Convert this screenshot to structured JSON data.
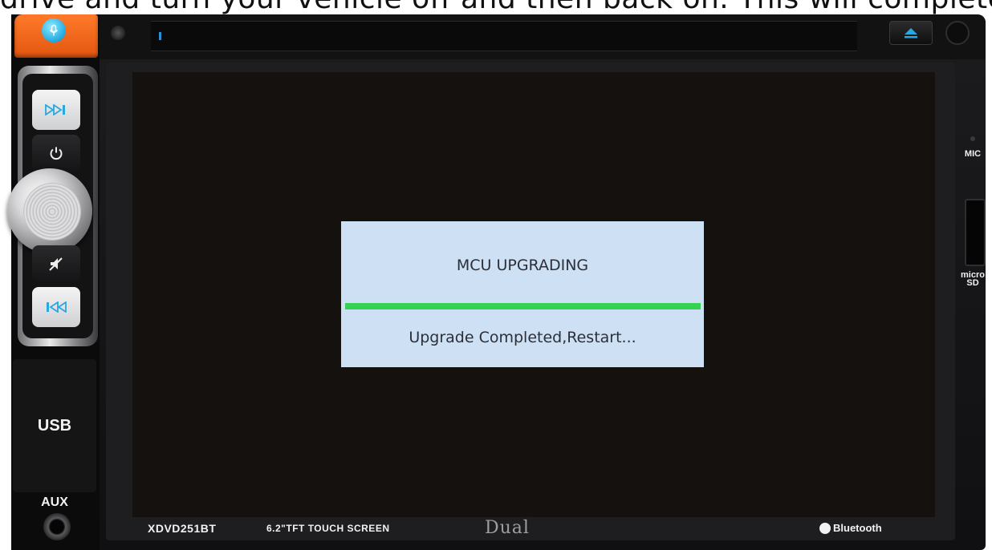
{
  "caption": {
    "text": "drive and turn your vehicle off and then back on. This will complete the MCU update."
  },
  "dialog": {
    "title": "MCU UPGRADING",
    "status": "Upgrade Completed,Restart...",
    "progress_percent": 100
  },
  "front_panel": {
    "model": "XDVD251BT",
    "screen_spec": "6.2\"TFT TOUCH SCREEN",
    "brand": "Dual",
    "bluetooth": "Bluetooth",
    "usb_label": "USB",
    "aux_label": "AUX",
    "mic_label": "MIC",
    "sd_label_top": "micro",
    "sd_label_bottom": "SD"
  },
  "colors": {
    "dialog_bg": "#cde0f4",
    "progress": "#33d253",
    "mic_key": "#e2560f",
    "button_icon": "#29a8e0"
  },
  "icons": {
    "voice": "microphone-icon",
    "next": "skip-forward-icon",
    "power": "power-icon",
    "mute": "mute-icon",
    "prev": "skip-back-icon",
    "eject": "eject-icon"
  }
}
